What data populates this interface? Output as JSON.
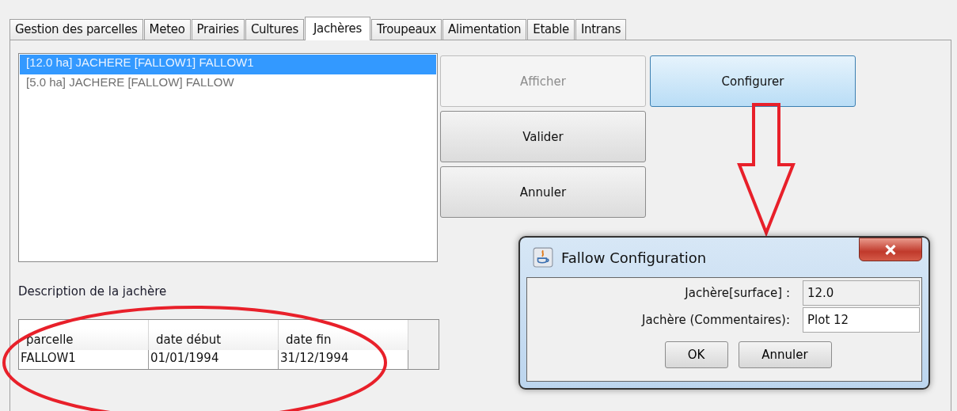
{
  "tabs": [
    {
      "label": "Gestion des parcelles",
      "selected": false
    },
    {
      "label": "Meteo",
      "selected": false
    },
    {
      "label": "Prairies",
      "selected": false
    },
    {
      "label": "Cultures",
      "selected": false
    },
    {
      "label": "Jachères",
      "selected": true
    },
    {
      "label": "Troupeaux",
      "selected": false
    },
    {
      "label": "Alimentation",
      "selected": false
    },
    {
      "label": "Etable",
      "selected": false
    },
    {
      "label": "Intrans",
      "selected": false
    }
  ],
  "fallow_list": [
    {
      "label": "[12.0 ha] JACHERE [FALLOW1] FALLOW1",
      "selected": true
    },
    {
      "label": "[5.0 ha] JACHERE [FALLOW] FALLOW",
      "selected": false
    }
  ],
  "buttons": [
    {
      "label": "Afficher",
      "disabled": true,
      "highlighted": false
    },
    {
      "label": "Configurer",
      "disabled": false,
      "highlighted": true
    },
    {
      "label": "Valider",
      "disabled": false,
      "highlighted": false
    },
    {
      "label": "Annuler",
      "disabled": false,
      "highlighted": false
    }
  ],
  "description_label": "Description de la jachère",
  "table": {
    "columns": [
      "parcelle",
      "date début",
      "date fin"
    ],
    "rows": [
      [
        "FALLOW1",
        "01/01/1994",
        "31/12/1994"
      ]
    ]
  },
  "dialog": {
    "title": "Fallow Configuration",
    "fields": [
      {
        "label": "Jachère[surface] :",
        "value": "12.0",
        "editable": false
      },
      {
        "label": "Jachère (Commentaires):",
        "value": "Plot 12",
        "editable": true
      }
    ],
    "buttons": [
      "OK",
      "Annuler"
    ]
  }
}
